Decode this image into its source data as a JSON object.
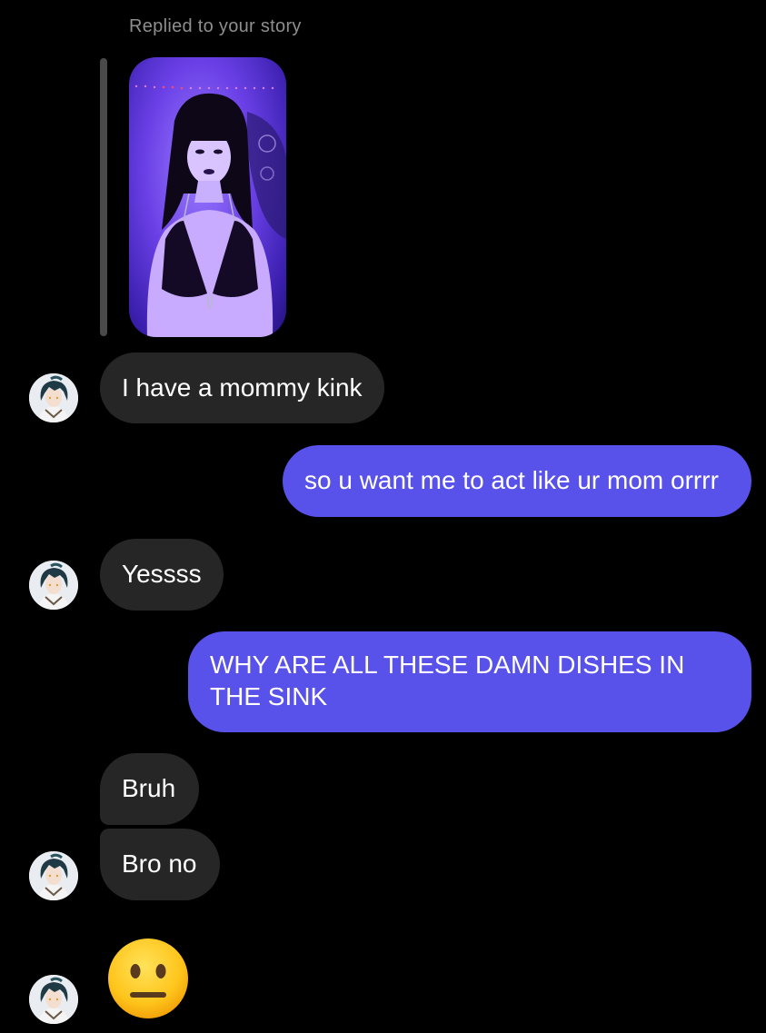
{
  "reply": {
    "header": "Replied to your story"
  },
  "messages": [
    {
      "id": "m1",
      "side": "in",
      "text": "I have a mommy kink"
    },
    {
      "id": "m2",
      "side": "out",
      "text": "so u want me to act like ur mom orrrr"
    },
    {
      "id": "m3",
      "side": "in",
      "text": "Yessss"
    },
    {
      "id": "m4",
      "side": "out",
      "text": "WHY ARE ALL THESE DAMN DISHES IN THE SINK"
    },
    {
      "id": "m5",
      "side": "in",
      "text": "Bruh"
    },
    {
      "id": "m6",
      "side": "in",
      "text": "Bro no"
    },
    {
      "id": "m7",
      "side": "in",
      "emoji": "neutral-face"
    }
  ],
  "colors": {
    "background": "#000000",
    "incoming_bubble": "#262626",
    "outgoing_bubble": "#5851ea",
    "muted_text": "#8e8e8e"
  }
}
